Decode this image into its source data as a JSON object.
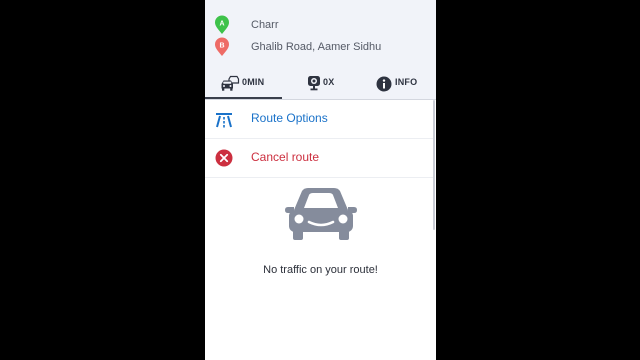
{
  "colors": {
    "background": "#000000",
    "panel": "#ffffff",
    "header_bg": "#f1f3f9",
    "start_pin": "#3ec24a",
    "end_pin": "#ee6b66",
    "link_blue": "#1a72c9",
    "cancel_red": "#cc2f3f",
    "car_gray": "#858c9c"
  },
  "route": {
    "start": {
      "marker": "A",
      "name": "Charr"
    },
    "end": {
      "marker": "B",
      "name": "Ghalib Road, Aamer Sidhu"
    }
  },
  "tabs": [
    {
      "icon": "traffic-car-icon",
      "label": "0MIN",
      "active": true
    },
    {
      "icon": "speed-camera-icon",
      "label": "0X",
      "active": false
    },
    {
      "icon": "info-icon",
      "label": "INFO",
      "active": false
    }
  ],
  "menu": {
    "route_options": {
      "icon": "highway-icon",
      "label": "Route Options"
    },
    "cancel_route": {
      "icon": "cancel-icon",
      "label": "Cancel route"
    }
  },
  "traffic": {
    "icon": "car-icon",
    "message": "No traffic on your route!"
  }
}
